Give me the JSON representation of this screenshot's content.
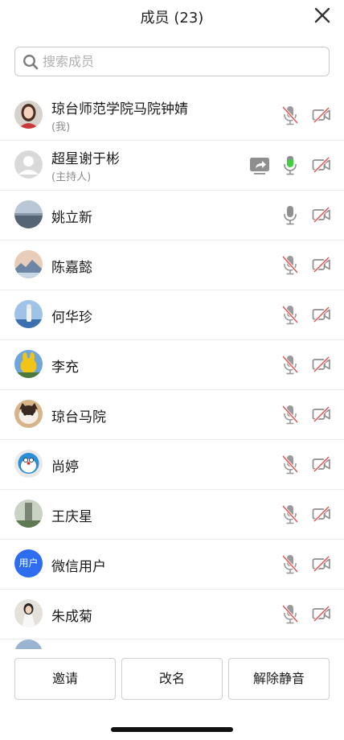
{
  "header": {
    "title": "成员 (23)"
  },
  "search": {
    "placeholder": "搜索成员",
    "value": ""
  },
  "members": [
    {
      "name": "琼台师范学院马院钟婧",
      "sub": "(我)",
      "avatar": "photo",
      "mic": "muted",
      "camera": "off"
    },
    {
      "name": "超星谢于彬",
      "sub": "(主持人)",
      "avatar": "default",
      "sharing": true,
      "mic": "on-green",
      "camera": "off"
    },
    {
      "name": "姚立新",
      "avatar": "photo",
      "mic": "on",
      "camera": "off"
    },
    {
      "name": "陈嘉懿",
      "avatar": "photo",
      "mic": "muted",
      "camera": "off"
    },
    {
      "name": "何华珍",
      "avatar": "photo",
      "mic": "muted",
      "camera": "off"
    },
    {
      "name": "李充",
      "avatar": "photo",
      "mic": "muted",
      "camera": "off"
    },
    {
      "name": "琼台马院",
      "avatar": "photo",
      "mic": "muted",
      "camera": "off"
    },
    {
      "name": "尚婷",
      "avatar": "photo",
      "mic": "muted",
      "camera": "off"
    },
    {
      "name": "王庆星",
      "avatar": "photo",
      "mic": "muted",
      "camera": "off"
    },
    {
      "name": "微信用户",
      "avatar": "text",
      "avatar_text": "用户",
      "mic": "muted",
      "camera": "off"
    },
    {
      "name": "朱成菊",
      "avatar": "photo",
      "mic": "muted",
      "camera": "off"
    }
  ],
  "buttons": {
    "invite": "邀请",
    "rename": "改名",
    "unmute_all": "解除静音"
  },
  "colors": {
    "muted_red": "#e0504e",
    "mic_green": "#3fcf3f",
    "icon_gray": "#9a9a9a",
    "avatar_blue": "#2e6cf0"
  }
}
